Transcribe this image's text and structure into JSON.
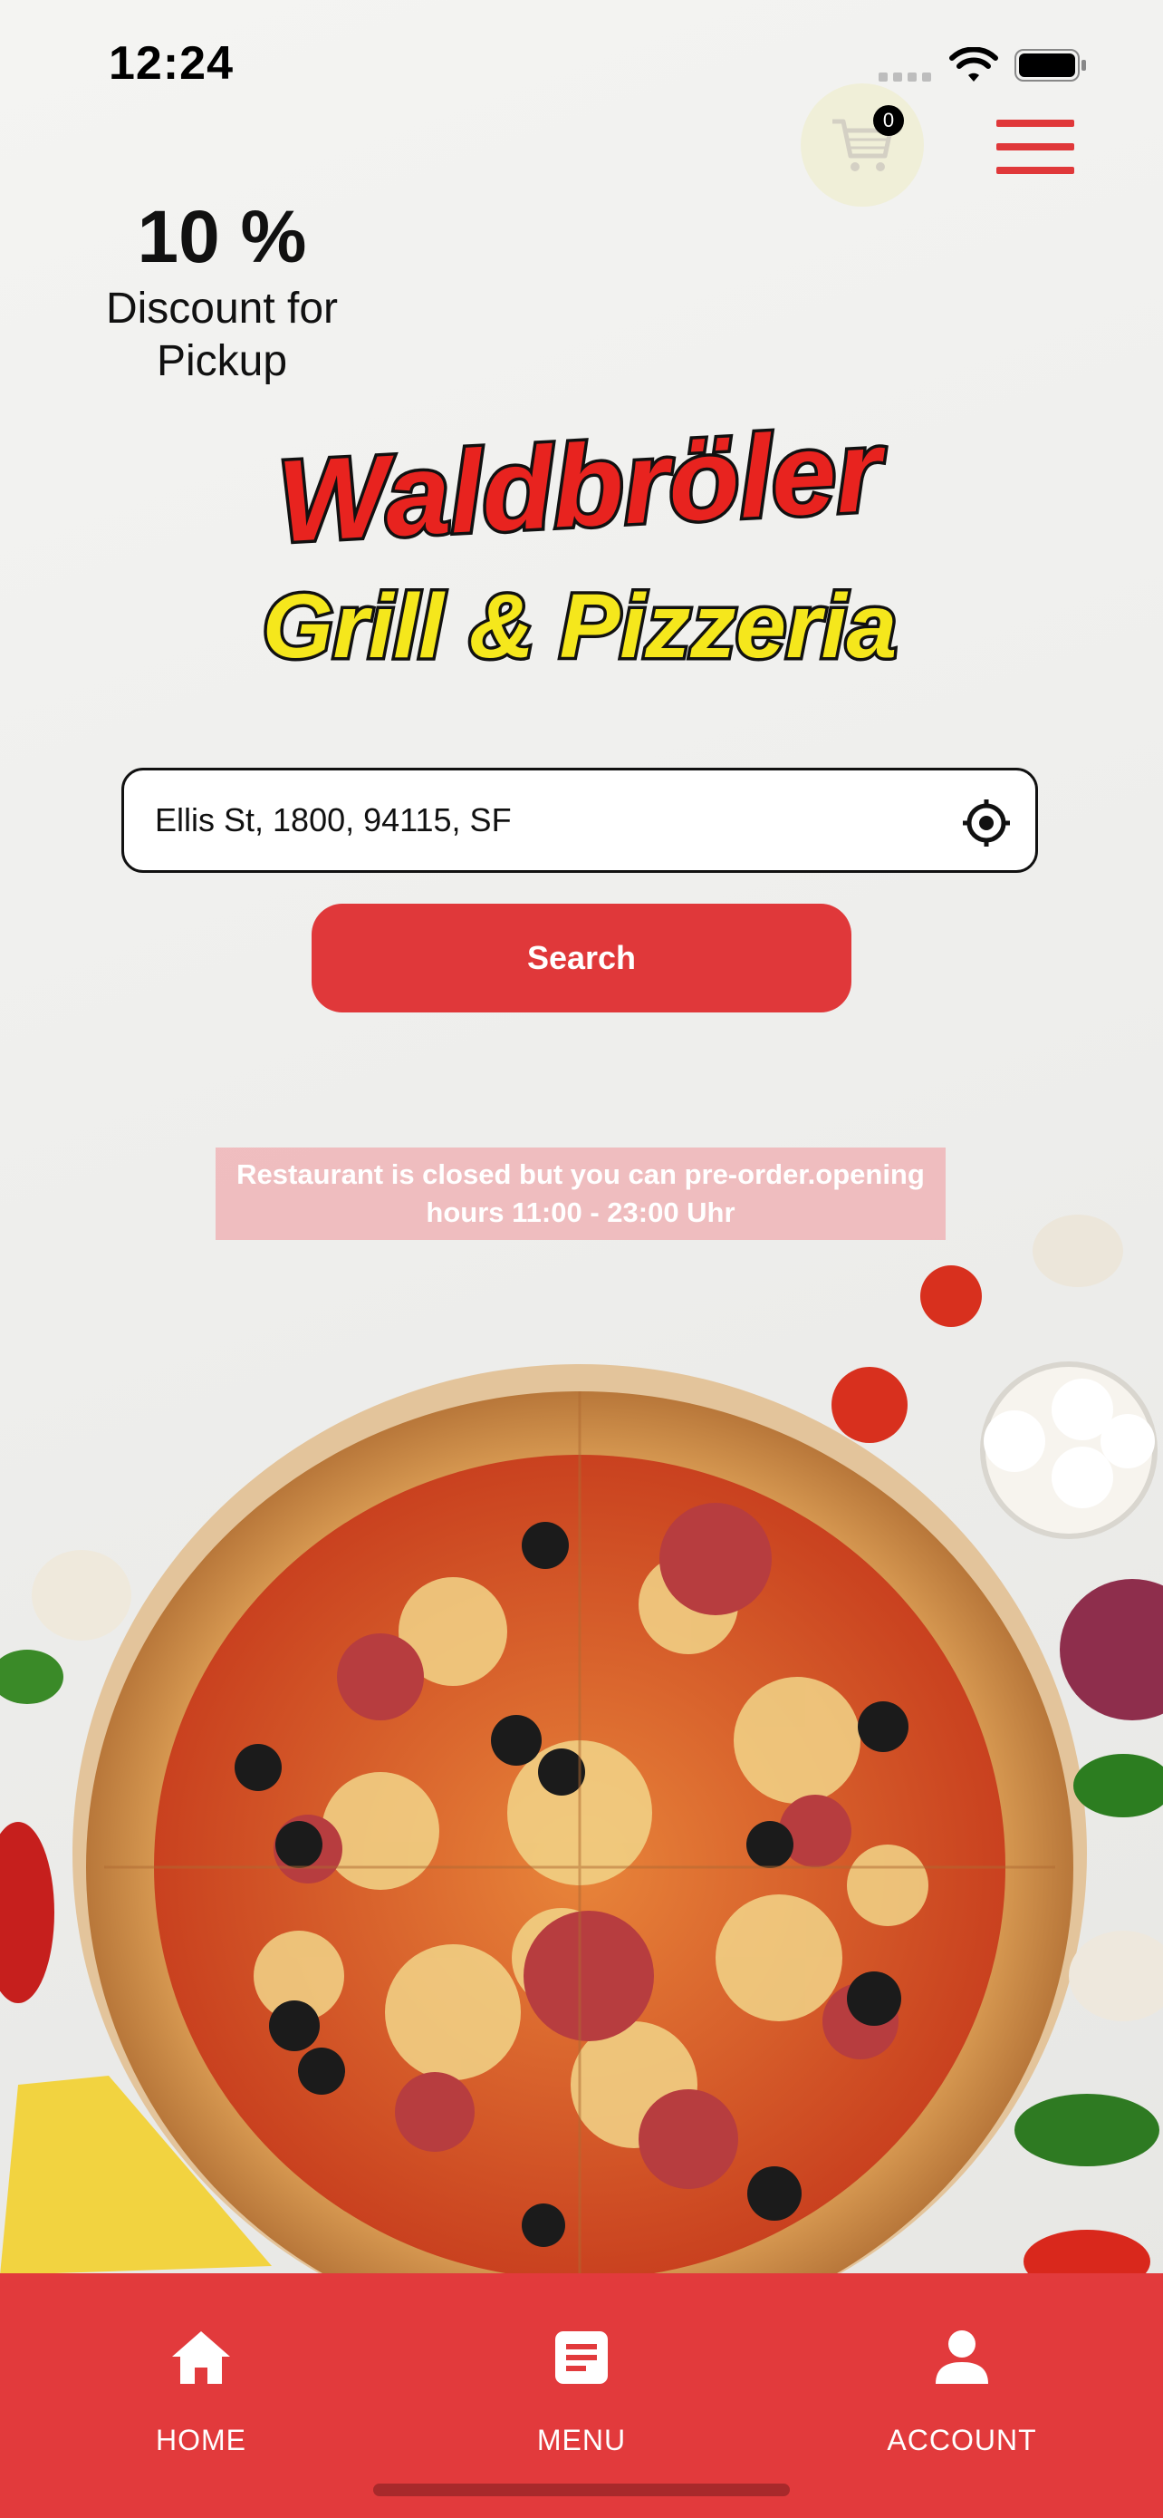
{
  "status_bar": {
    "time": "12:24"
  },
  "header": {
    "cart_count": "0",
    "cart_icon": "cart-icon",
    "menu_icon": "hamburger-icon"
  },
  "promo": {
    "discount": "10 %",
    "text": "Discount for Pickup"
  },
  "logo": {
    "line1": "Waldbröler",
    "line2": "Grill & Pizzeria"
  },
  "search": {
    "address_value": "Ellis St, 1800, 94115, SF",
    "locate_icon": "crosshair-icon",
    "button_label": "Search"
  },
  "notice": {
    "text": "Restaurant is closed but you can pre-order.opening hours 11:00 - 23:00 Uhr"
  },
  "bottom_nav": {
    "items": [
      {
        "label": "HOME",
        "icon": "home-icon"
      },
      {
        "label": "MENU",
        "icon": "menu-icon"
      },
      {
        "label": "ACCOUNT",
        "icon": "person-icon"
      }
    ]
  },
  "colors": {
    "accent": "#e0383a",
    "logo_red": "#e8231f",
    "logo_yellow": "#f5e71c"
  }
}
